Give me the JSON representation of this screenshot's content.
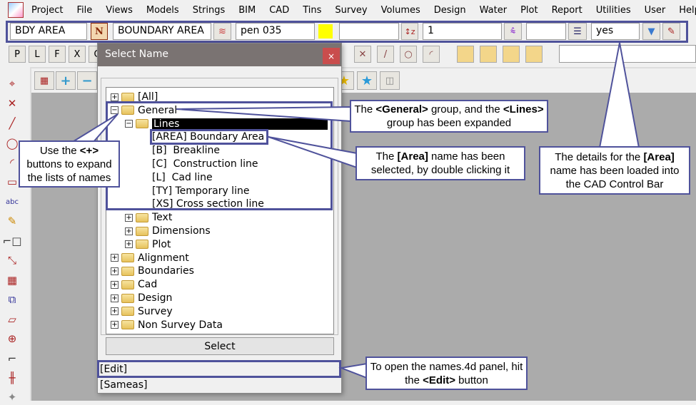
{
  "menu": [
    "Project",
    "File",
    "Views",
    "Models",
    "Strings",
    "BIM",
    "CAD",
    "Tins",
    "Survey",
    "Volumes",
    "Design",
    "Water",
    "Plot",
    "Report",
    "Utilities",
    "User",
    "Help"
  ],
  "control_bar": {
    "name_code": "BDY AREA",
    "name_button": "N",
    "model": "BOUNDARY AREA",
    "linestyle": "pen 035",
    "colour": "#ffff00",
    "height": "",
    "weight": "1",
    "thickness": "",
    "breakline": "yes"
  },
  "toolbar2": [
    "P",
    "L",
    "F",
    "X",
    "C"
  ],
  "dialog": {
    "title": "Select Name",
    "close": "×",
    "select_label": "Select",
    "edit_label": "[Edit]",
    "sameas_label": "[Sameas]",
    "tree": [
      {
        "label": "[All]",
        "level": 0,
        "expander": "+"
      },
      {
        "label": "General",
        "level": 0,
        "expander": "−"
      },
      {
        "label": "Lines",
        "level": 1,
        "expander": "−",
        "selected": true
      },
      {
        "label": "[AREA] Boundary Area",
        "level": 2
      },
      {
        "label": "[B]  Breakline",
        "level": 2
      },
      {
        "label": "[C]  Construction line",
        "level": 2
      },
      {
        "label": "[L]  Cad line",
        "level": 2
      },
      {
        "label": "[TY] Temporary line",
        "level": 2
      },
      {
        "label": "[XS] Cross section line",
        "level": 2
      },
      {
        "label": "Text",
        "level": 1,
        "expander": "+"
      },
      {
        "label": "Dimensions",
        "level": 1,
        "expander": "+"
      },
      {
        "label": "Plot",
        "level": 1,
        "expander": "+"
      },
      {
        "label": "Alignment",
        "level": 0,
        "expander": "+"
      },
      {
        "label": "Boundaries",
        "level": 0,
        "expander": "+"
      },
      {
        "label": "Cad",
        "level": 0,
        "expander": "+"
      },
      {
        "label": "Design",
        "level": 0,
        "expander": "+"
      },
      {
        "label": "Survey",
        "level": 0,
        "expander": "+"
      },
      {
        "label": "Non Survey Data",
        "level": 0,
        "expander": "+"
      }
    ]
  },
  "callouts": {
    "expand": "Use the <b>&lt;+&gt;</b> buttons to expand the lists of names",
    "general": "The <b>&lt;General&gt;</b> group, and the <b>&lt;Lines&gt;</b> group has been expanded",
    "area": "The <b>[Area]</b> name has been selected, by double clicking it",
    "details": "The details for the <b>[Area]</b> name has been loaded into the CAD Control Bar",
    "edit": "To open the names.4d panel, hit the <b>&lt;Edit&gt;</b> button"
  },
  "accent": "#4f529b"
}
